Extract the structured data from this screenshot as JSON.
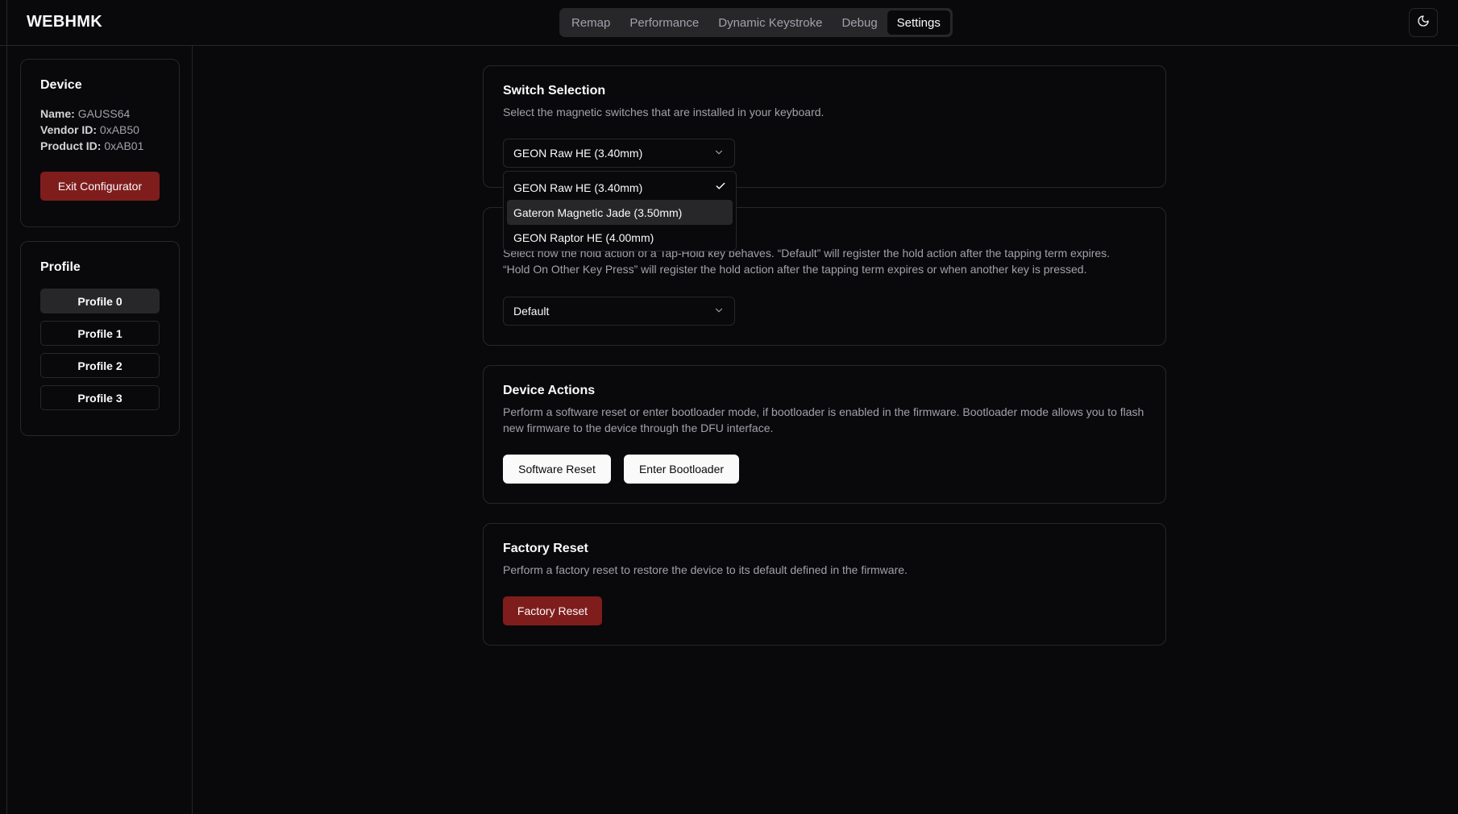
{
  "app": {
    "title": "WEBHMK"
  },
  "nav": {
    "tabs": [
      {
        "label": "Remap"
      },
      {
        "label": "Performance"
      },
      {
        "label": "Dynamic Keystroke"
      },
      {
        "label": "Debug"
      },
      {
        "label": "Settings"
      }
    ],
    "active_tab": "Settings",
    "theme_toggle_icon": "moon-icon"
  },
  "sidebar": {
    "device": {
      "title": "Device",
      "name_label": "Name:",
      "name_value": "GAUSS64",
      "vendor_label": "Vendor ID:",
      "vendor_value": "0xAB50",
      "product_label": "Product ID:",
      "product_value": "0xAB01",
      "exit_button": "Exit Configurator"
    },
    "profile": {
      "title": "Profile",
      "items": [
        "Profile 0",
        "Profile 1",
        "Profile 2",
        "Profile 3"
      ],
      "active_index": 0
    }
  },
  "switch_selection": {
    "title": "Switch Selection",
    "description": "Select the magnetic switches that are installed in your keyboard.",
    "selected": "GEON Raw HE (3.40mm)",
    "options": [
      {
        "label": "GEON Raw HE (3.40mm)",
        "checked": true
      },
      {
        "label": "Gateron Magnetic Jade (3.50mm)",
        "checked": false
      },
      {
        "label": "GEON Raptor HE (4.00mm)",
        "checked": false
      }
    ]
  },
  "tap_hold": {
    "description_line1": "Select how the hold action of a Tap-Hold key behaves. “Default” will register the hold action after the tapping term expires.",
    "description_line2": "“Hold On Other Key Press” will register the hold action after the tapping term expires or when another key is pressed.",
    "description_visible_tail": "behaves. “Default” will register the hold action after the tapping term expires.",
    "selected": "Default"
  },
  "device_actions": {
    "title": "Device Actions",
    "description": "Perform a software reset or enter bootloader mode, if bootloader is enabled in the firmware. Bootloader mode allows you to flash new firmware to the device through the DFU interface.",
    "software_reset": "Software Reset",
    "enter_bootloader": "Enter Bootloader"
  },
  "factory_reset": {
    "title": "Factory Reset",
    "description": "Perform a factory reset to restore the device to its default defined in the firmware.",
    "button": "Factory Reset"
  },
  "colors": {
    "background": "#09090b",
    "border": "#27272a",
    "danger": "#7f1d1d",
    "muted_text": "#a1a1aa"
  }
}
